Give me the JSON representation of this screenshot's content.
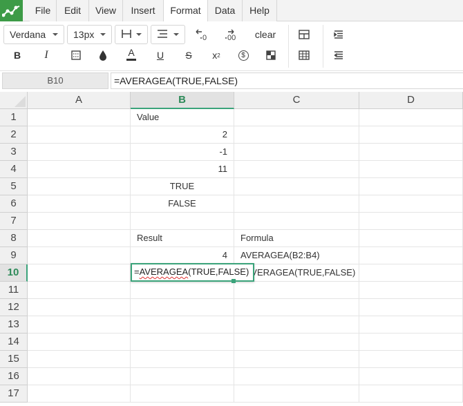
{
  "menu": {
    "logo_icon": "spreadsheet-logo-icon",
    "items": [
      {
        "label": "File"
      },
      {
        "label": "Edit"
      },
      {
        "label": "View"
      },
      {
        "label": "Insert"
      },
      {
        "label": "Format"
      },
      {
        "label": "Data"
      },
      {
        "label": "Help"
      }
    ],
    "active": "Format"
  },
  "toolbar": {
    "font_family": "Verdana",
    "font_size": "13px",
    "clear_label": "clear",
    "bold": "B",
    "italic": "I",
    "text_color": "A",
    "underline": "U",
    "strike": "S",
    "superscript": "x",
    "superscript_mark": "2",
    "currency": "$",
    "decrease_decimals": "0",
    "increase_decimals": "00"
  },
  "formula_bar": {
    "cell_ref": "B10",
    "formula": "=AVERAGEA(TRUE,FALSE)"
  },
  "grid": {
    "columns": [
      "A",
      "B",
      "C",
      "D"
    ],
    "rows": [
      "1",
      "2",
      "3",
      "4",
      "5",
      "6",
      "7",
      "8",
      "9",
      "10",
      "11",
      "12",
      "13",
      "14",
      "15",
      "16",
      "17"
    ],
    "selected_column": "B",
    "selected_row": "10",
    "cells": {
      "B1": "Value",
      "B2": "2",
      "B3": "-1",
      "B4": "11",
      "B5": "TRUE",
      "B6": "FALSE",
      "B8": "Result",
      "C8": "Formula",
      "B9": "4",
      "C9": "AVERAGEA(B2:B4)",
      "C10": "=AVERAGEA(TRUE,FALSE)"
    },
    "editor": {
      "prefix": "=",
      "function_name": "AVERAGEA",
      "args": "(TRUE,FALSE)"
    }
  },
  "colors": {
    "accent": "#3aa37a",
    "logo": "#3d9b47",
    "selected_header_text": "#2d8a59"
  }
}
